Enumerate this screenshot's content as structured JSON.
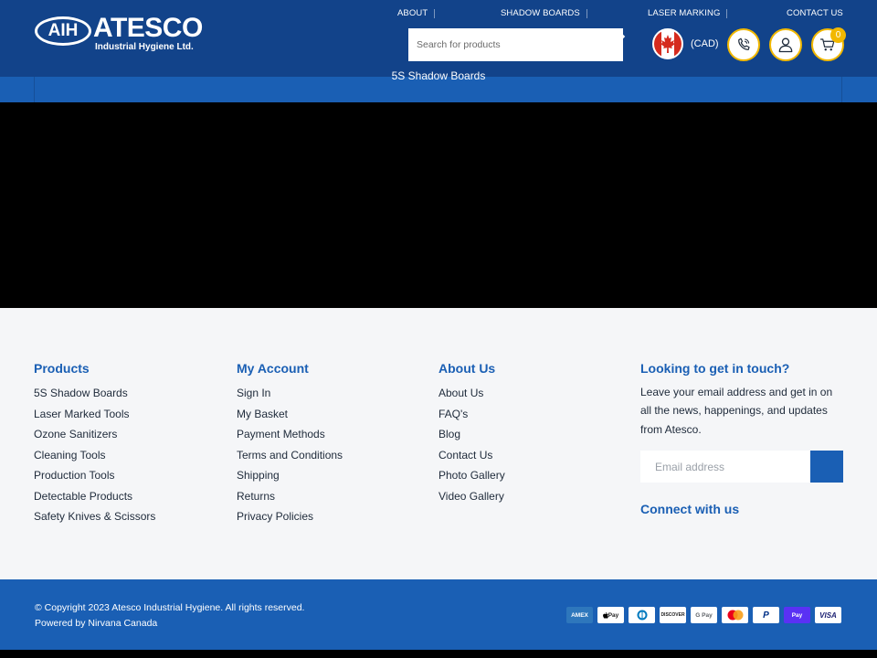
{
  "brand": {
    "oval": "AIH",
    "name": "ATESCO",
    "sub": "Industrial Hygiene Ltd."
  },
  "top_nav": [
    "About",
    "Shadow Boards",
    "Laser Marking",
    "Contact Us"
  ],
  "search": {
    "placeholder": "Search for products"
  },
  "currency": "(CAD)",
  "cart": {
    "count": "0"
  },
  "subnav": {
    "link": "5S Shadow Boards"
  },
  "footer": {
    "products": {
      "title": "Products",
      "items": [
        "5S Shadow Boards",
        "Laser Marked Tools",
        "Ozone Sanitizers",
        "Cleaning Tools",
        "Production Tools",
        "Detectable Products",
        "Safety Knives & Scissors"
      ]
    },
    "account": {
      "title": "My Account",
      "items": [
        "Sign In",
        "My Basket",
        "Payment Methods",
        "Terms and Conditions",
        "Shipping",
        "Returns",
        "Privacy Policies"
      ]
    },
    "about": {
      "title": "About Us",
      "items": [
        "About Us",
        "FAQ's",
        "Blog",
        "Contact Us",
        "Photo Gallery",
        "Video Gallery"
      ]
    },
    "touch": {
      "title": "Looking to get in touch?",
      "text": "Leave your email address and get in on all the news, happenings, and updates from Atesco.",
      "email_placeholder": "Email address",
      "connect": "Connect with us"
    },
    "copyright": "© Copyright 2023 Atesco Industrial Hygiene. All rights reserved.",
    "powered": "Powered by Nirvana Canada",
    "payments": [
      "AMEX",
      "Pay",
      "",
      "DISCOVER",
      "G Pay",
      "",
      "P",
      "Pay",
      "VISA"
    ]
  },
  "colors": {
    "header": "#12438a",
    "accent": "#1a5fb4",
    "cart_ring": "#f2b800"
  },
  "icons": {
    "flag": "canada-flag-icon",
    "phone": "phone-icon",
    "account": "user-icon",
    "cart": "cart-icon"
  }
}
